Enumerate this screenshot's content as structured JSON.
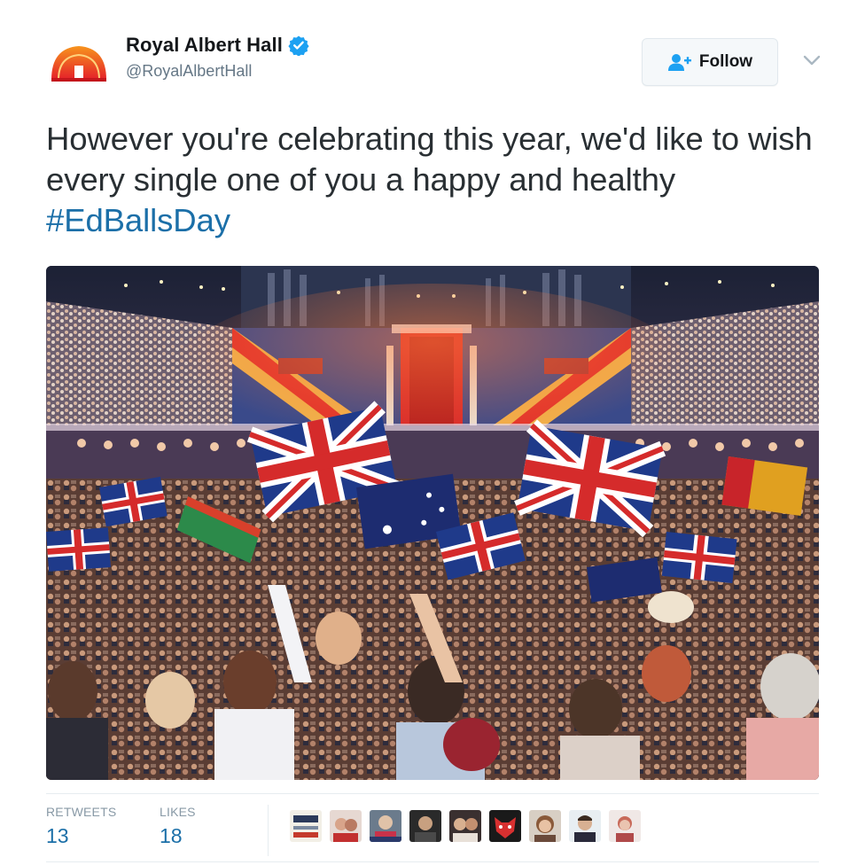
{
  "author": {
    "display_name": "Royal Albert Hall",
    "handle": "@RoyalAlbertHall",
    "verified": true,
    "avatar_icon": "royal-albert-hall-logo-icon"
  },
  "actions": {
    "follow_label": "Follow",
    "follow_icon": "add-user-icon",
    "menu_icon": "chevron-down-icon"
  },
  "tweet": {
    "text_before_hashtag": "However you're celebrating this year, we'd like to wish every single one of you a happy and healthy ",
    "hashtag": "#EdBallsDay",
    "photo_icon": "concert-hall-flags-photo"
  },
  "stats": {
    "retweets_label": "RETWEETS",
    "retweets_count": "13",
    "likes_label": "LIKES",
    "likes_count": "18"
  },
  "likers": [
    {
      "icon": "liker-avatar-1"
    },
    {
      "icon": "liker-avatar-2"
    },
    {
      "icon": "liker-avatar-3"
    },
    {
      "icon": "liker-avatar-4"
    },
    {
      "icon": "liker-avatar-5"
    },
    {
      "icon": "liker-avatar-6"
    },
    {
      "icon": "liker-avatar-7"
    },
    {
      "icon": "liker-avatar-8"
    },
    {
      "icon": "liker-avatar-9"
    }
  ],
  "colors": {
    "link": "#1b6fa8",
    "verified": "#1da1f2",
    "logo_orange": "#f26522",
    "logo_red": "#d7191c",
    "text": "#292f33",
    "muted": "#657786"
  }
}
